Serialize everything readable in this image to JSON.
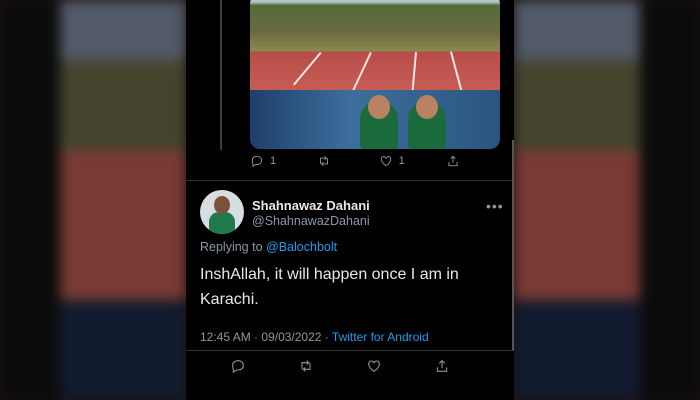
{
  "colors": {
    "accent": "#1d9bf0",
    "text_primary": "#e7e9ea",
    "text_secondary": "#8b98a5",
    "background": "#000000"
  },
  "parent_tweet": {
    "actions": {
      "reply_count": "1",
      "retweet_count": "",
      "like_count": "1"
    }
  },
  "tweet": {
    "display_name": "Shahnawaz Dahani",
    "handle": "@ShahnawazDahani",
    "replying_to_prefix": "Replying to",
    "replying_to_handle": "@Balochbolt",
    "text": "InshAllah, it will happen once I am in Karachi.",
    "time": "12:45 AM",
    "date": "09/03/2022",
    "separator": "·",
    "source": "Twitter for Android",
    "more_icon": "more-horizontal-icon"
  },
  "icons": {
    "reply": "reply-icon",
    "retweet": "retweet-icon",
    "like": "like-icon",
    "share": "share-icon"
  }
}
